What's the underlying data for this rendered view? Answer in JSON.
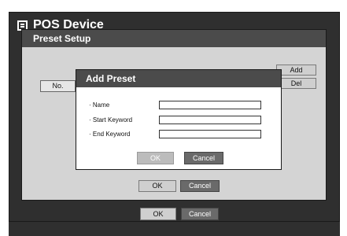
{
  "window": {
    "title": "POS Device",
    "icon": "list-icon"
  },
  "preset_setup": {
    "title": "Preset Setup",
    "add_label": "Add",
    "del_label": "Del",
    "column_no": "No.",
    "ok_label": "OK",
    "cancel_label": "Cancel"
  },
  "add_preset": {
    "title": "Add Preset",
    "fields": [
      {
        "label": "· Name",
        "value": ""
      },
      {
        "label": "· Start Keyword",
        "value": ""
      },
      {
        "label": "· End Keyword",
        "value": ""
      }
    ],
    "ok_label": "OK",
    "cancel_label": "Cancel"
  },
  "footer": {
    "ok_label": "OK",
    "cancel_label": "Cancel"
  }
}
